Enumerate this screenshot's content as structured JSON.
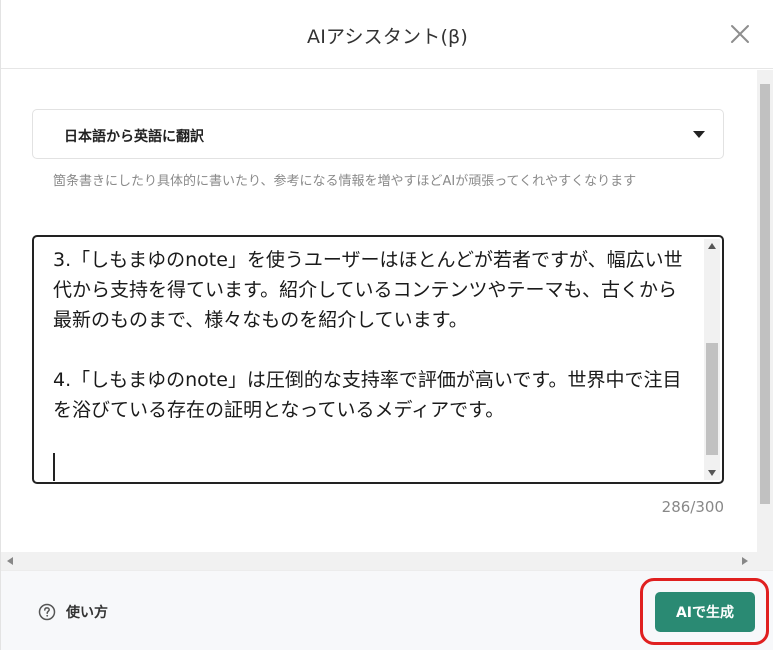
{
  "dialog": {
    "title": "AIアシスタント(β)"
  },
  "prompt_select": {
    "selected": "日本語から英語に翻訳"
  },
  "hint": {
    "text": "箇条書きにしたり具体的に書いたり、参考になる情報を増やすほどAIが頑張ってくれやすくなります"
  },
  "editor": {
    "content": "3.「しもまゆのnote」を使うユーザーはほとんどが若者ですが、幅広い世代から支持を得ています。紹介しているコンテンツやテーマも、古くから最新のものまで、様々なものを紹介しています。\n\n4.「しもまゆのnote」は圧倒的な支持率で評価が高いです。世界中で注目を浴びている存在の証明となっているメディアです。",
    "char_count": "286/300"
  },
  "footer": {
    "help_label": "使い方",
    "generate_label": "AIで生成"
  },
  "colors": {
    "primary_button": "#2a8a73",
    "highlight_outline": "#e02020"
  }
}
